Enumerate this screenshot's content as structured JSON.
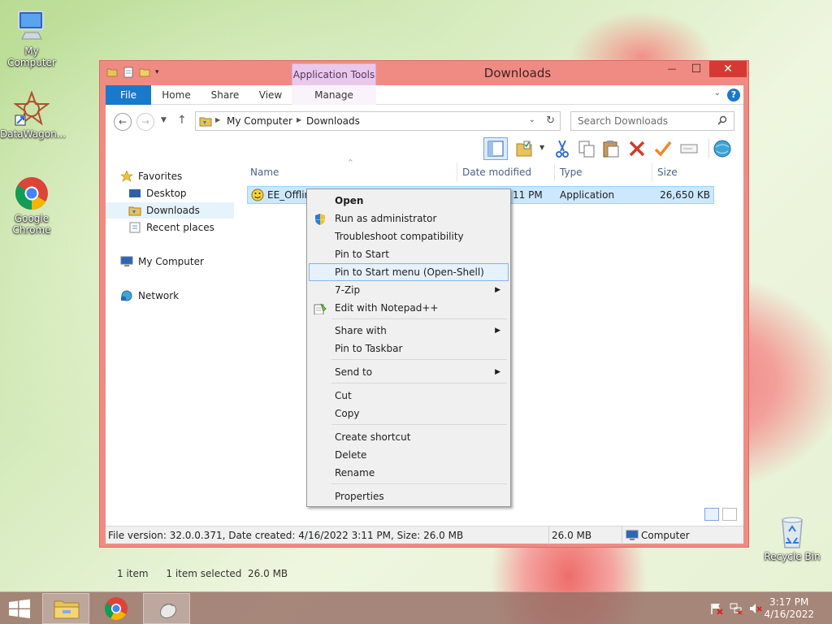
{
  "desktop": {
    "icons": [
      {
        "label": "My Computer"
      },
      {
        "label": "DataWagon..."
      },
      {
        "label": "Google Chrome"
      },
      {
        "label": "Recycle Bin"
      }
    ]
  },
  "window": {
    "title": "Downloads",
    "app_tools_label": "Application Tools",
    "ribbon_tabs": [
      "File",
      "Home",
      "Share",
      "View",
      "Manage"
    ],
    "close_symbol": "✕",
    "minimize_symbol": "—",
    "maximize_symbol": "☐"
  },
  "address": {
    "crumbs": [
      "My Computer",
      "Downloads"
    ],
    "search_placeholder": "Search Downloads"
  },
  "nav_pane": {
    "favorites_label": "Favorites",
    "items": [
      "Desktop",
      "Downloads",
      "Recent places"
    ],
    "computer_label": "My Computer",
    "network_label": "Network"
  },
  "columns": {
    "name": "Name",
    "date_modified": "Date modified",
    "type": "Type",
    "size": "Size"
  },
  "file": {
    "name": "EE_Offline",
    "date_fragment": "11 PM",
    "type": "Application",
    "size": "26,650 KB"
  },
  "status_bar": {
    "count": "1 item",
    "selected": "1 item selected  26.0 MB"
  },
  "details_bar": {
    "info": "File version: 32.0.0.371, Date created: 4/16/2022 3:11 PM, Size: 26.0 MB",
    "size": "26.0 MB",
    "location": "Computer"
  },
  "context_menu": {
    "items": [
      "Open",
      "Run as administrator",
      "Troubleshoot compatibility",
      "Pin to Start",
      "Pin to Start menu (Open-Shell)",
      "7-Zip",
      "Edit with Notepad++",
      "Share with",
      "Pin to Taskbar",
      "Send to",
      "Cut",
      "Copy",
      "Create shortcut",
      "Delete",
      "Rename",
      "Properties"
    ]
  },
  "taskbar": {
    "time": "3:17 PM",
    "date": "4/16/2022"
  },
  "colors": {
    "window_frame": "#f08b84",
    "file_tab": "#1979ca",
    "close_button": "#d43a33",
    "app_tools": "#e9c9eb",
    "selection": "#cce8ff"
  }
}
